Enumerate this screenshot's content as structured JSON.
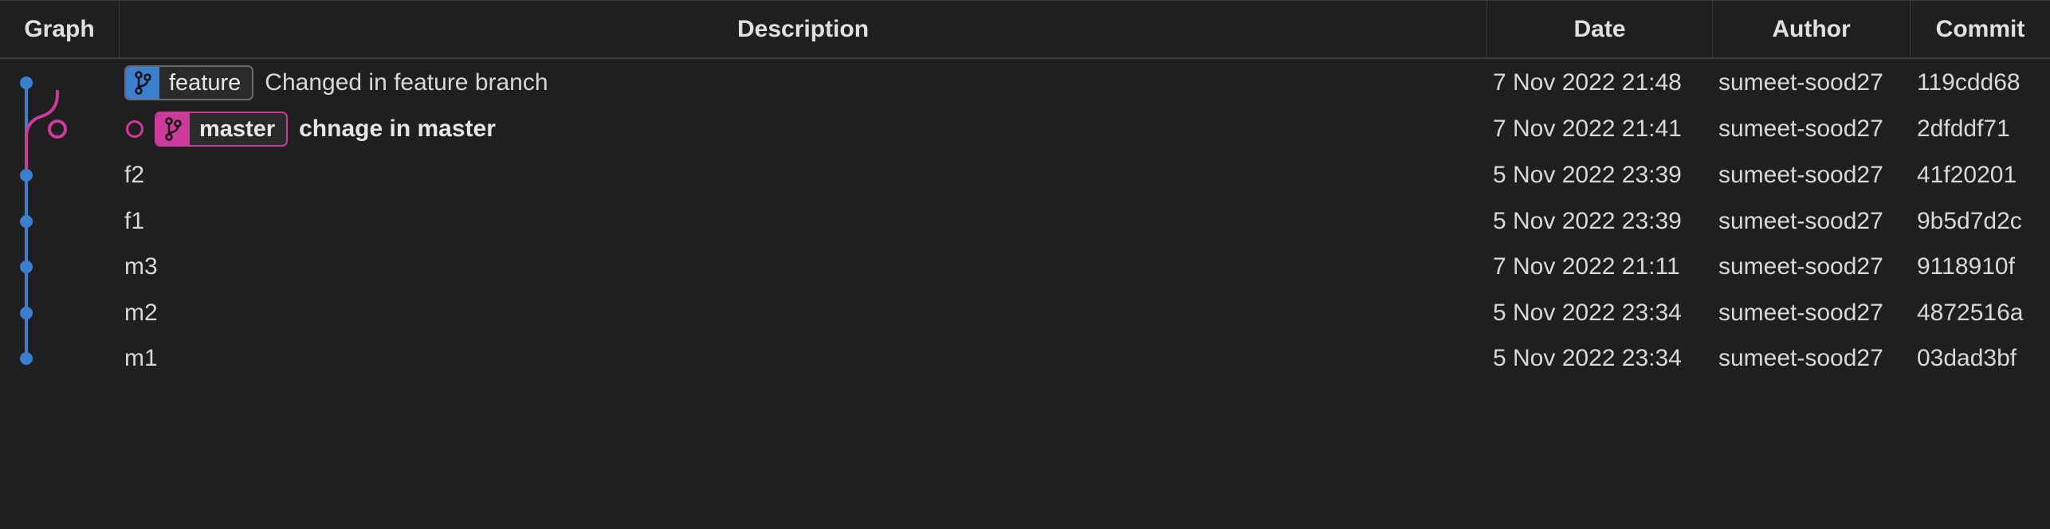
{
  "columns": {
    "graph": "Graph",
    "description": "Description",
    "date": "Date",
    "author": "Author",
    "commit": "Commit"
  },
  "colors": {
    "background": "#1f1f1f",
    "feature_branch": "#3b7fd0",
    "master_branch": "#cc3a9a"
  },
  "commits": [
    {
      "description": "Changed in feature branch",
      "date": "7 Nov 2022 21:48",
      "author": "sumeet-sood27",
      "commit": "119cdd68",
      "branch": "feature"
    },
    {
      "description": "chnage in master",
      "date": "7 Nov 2022 21:41",
      "author": "sumeet-sood27",
      "commit": "2dfddf71",
      "branch": "master",
      "head": true
    },
    {
      "description": "f2",
      "date": "5 Nov 2022 23:39",
      "author": "sumeet-sood27",
      "commit": "41f20201"
    },
    {
      "description": "f1",
      "date": "5 Nov 2022 23:39",
      "author": "sumeet-sood27",
      "commit": "9b5d7d2c"
    },
    {
      "description": "m3",
      "date": "7 Nov 2022 21:11",
      "author": "sumeet-sood27",
      "commit": "9118910f"
    },
    {
      "description": "m2",
      "date": "5 Nov 2022 23:34",
      "author": "sumeet-sood27",
      "commit": "4872516a"
    },
    {
      "description": "m1",
      "date": "5 Nov 2022 23:34",
      "author": "sumeet-sood27",
      "commit": "03dad3bf"
    }
  ],
  "branches": {
    "feature": "feature",
    "master": "master"
  },
  "icons": {
    "branch": "git-branch-icon",
    "head_marker": "head-ring-icon",
    "commit_node": "commit-dot-icon"
  }
}
